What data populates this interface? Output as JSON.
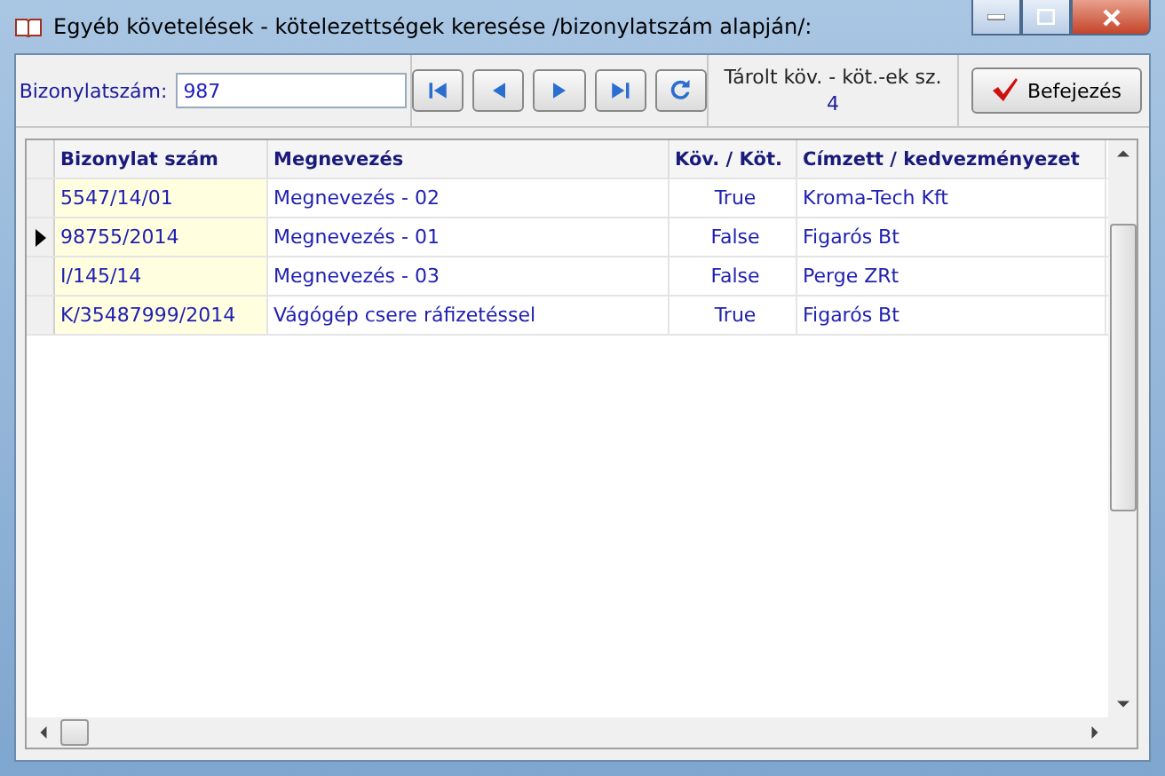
{
  "window": {
    "title": "Egyéb követelések - kötelezettségek keresése /bizonylatszám alapján/:"
  },
  "search": {
    "label": "Bizonylatszám:",
    "value": "987"
  },
  "stored": {
    "label": "Tárolt köv. - köt.-ek sz.",
    "count": "4"
  },
  "finish_button": "Befejezés",
  "table": {
    "columns": [
      "Bizonylat szám",
      "Megnevezés",
      "Köv. / Köt.",
      "Címzett / kedvezményezet"
    ],
    "rows": [
      {
        "cells": [
          "5547/14/01",
          "Megnevezés - 02",
          "True",
          "Kroma-Tech Kft"
        ],
        "selected": false
      },
      {
        "cells": [
          "98755/2014",
          "Megnevezés - 01",
          "False",
          "Figarós Bt"
        ],
        "selected": true
      },
      {
        "cells": [
          "I/145/14",
          "Megnevezés - 03",
          "False",
          "Perge ZRt"
        ],
        "selected": false
      },
      {
        "cells": [
          "K/35487999/2014",
          "Vágógép csere ráfizetéssel",
          "True",
          "Figarós Bt"
        ],
        "selected": false
      }
    ]
  }
}
